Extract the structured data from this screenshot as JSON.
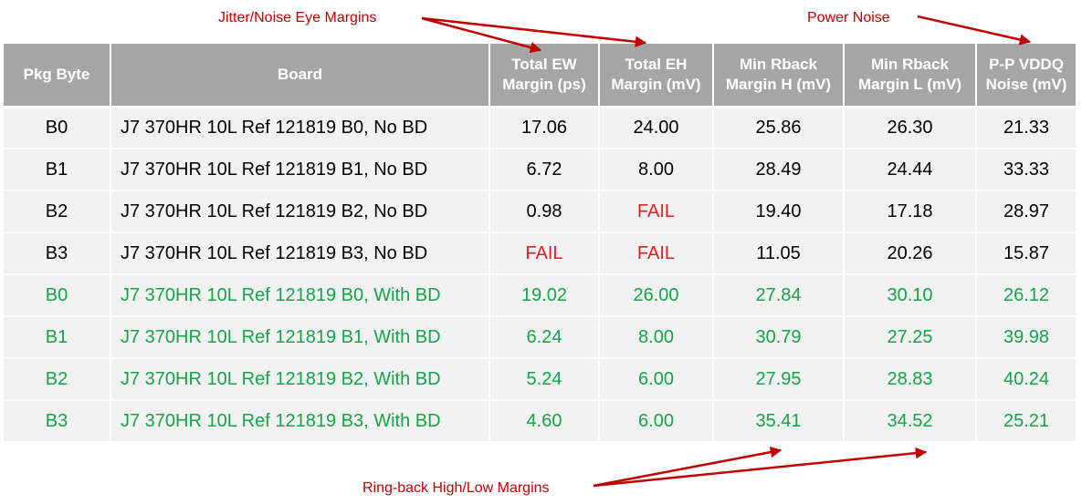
{
  "colors": {
    "annotation": "#c00000",
    "header_bg": "#a6a6a6",
    "cell_bg": "#f2f2f2",
    "with_bd_text": "#16a34a",
    "fail_text": "#e02020"
  },
  "annotations": {
    "jitter_noise": "Jitter/Noise Eye Margins",
    "power_noise": "Power Noise",
    "ringback": "Ring-back High/Low Margins"
  },
  "table": {
    "headers": [
      [
        "Pkg Byte"
      ],
      [
        "Board"
      ],
      [
        "Total EW",
        "Margin (ps)"
      ],
      [
        "Total EH",
        "Margin (mV)"
      ],
      [
        "Min Rback",
        "Margin H (mV)"
      ],
      [
        "Min Rback",
        "Margin L (mV)"
      ],
      [
        "P-P VDDQ",
        "Noise (mV)"
      ]
    ],
    "rows": [
      {
        "group": "no_bd",
        "cells": [
          "B0",
          "J7 370HR  10L Ref 121819  B0, No BD",
          "17.06",
          "24.00",
          "25.86",
          "26.30",
          "21.33"
        ]
      },
      {
        "group": "no_bd",
        "cells": [
          "B1",
          "J7 370HR  10L Ref 121819  B1, No BD",
          "6.72",
          "8.00",
          "28.49",
          "24.44",
          "33.33"
        ]
      },
      {
        "group": "no_bd",
        "cells": [
          "B2",
          "J7 370HR  10L Ref 121819  B2, No BD",
          "0.98",
          "FAIL",
          "19.40",
          "17.18",
          "28.97"
        ]
      },
      {
        "group": "no_bd",
        "cells": [
          "B3",
          "J7 370HR  10L Ref 121819  B3, No BD",
          "FAIL",
          "FAIL",
          "11.05",
          "20.26",
          "15.87"
        ]
      },
      {
        "group": "with_bd",
        "cells": [
          "B0",
          "J7 370HR  10L Ref 121819  B0, With BD",
          "19.02",
          "26.00",
          "27.84",
          "30.10",
          "26.12"
        ]
      },
      {
        "group": "with_bd",
        "cells": [
          "B1",
          "J7 370HR  10L Ref 121819  B1, With BD",
          "6.24",
          "8.00",
          "30.79",
          "27.25",
          "39.98"
        ]
      },
      {
        "group": "with_bd",
        "cells": [
          "B2",
          "J7 370HR  10L Ref 121819  B2, With BD",
          "5.24",
          "6.00",
          "27.95",
          "28.83",
          "40.24"
        ]
      },
      {
        "group": "with_bd",
        "cells": [
          "B3",
          "J7 370HR  10L Ref 121819  B3, With BD",
          "4.60",
          "6.00",
          "35.41",
          "34.52",
          "25.21"
        ]
      }
    ]
  }
}
